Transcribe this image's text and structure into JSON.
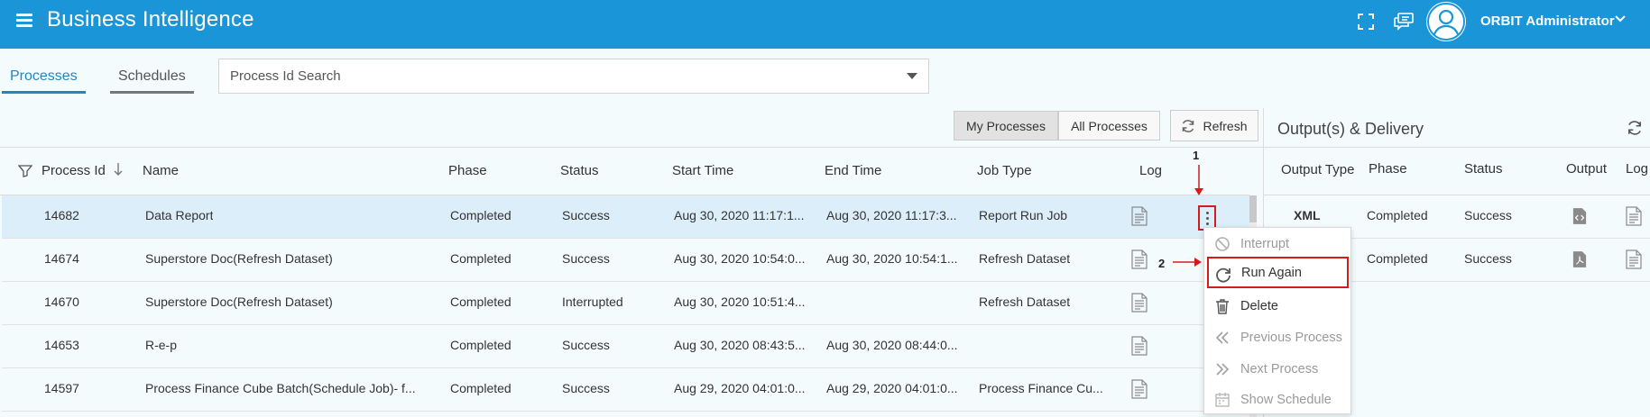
{
  "header": {
    "app_title": "Business Intelligence",
    "user_name": "ORBIT Administrator",
    "icons": [
      "menu-icon",
      "fullscreen-icon",
      "chat-icon",
      "avatar-icon",
      "chevron-down-icon"
    ]
  },
  "tabs": [
    {
      "label": "Processes",
      "active": true
    },
    {
      "label": "Schedules",
      "active": false
    }
  ],
  "search": {
    "placeholder": "Process Id Search",
    "value": ""
  },
  "toolbar": {
    "my_processes": "My Processes",
    "all_processes": "All Processes",
    "refresh": "Refresh",
    "selected_filter": "My Processes"
  },
  "table": {
    "columns": [
      "Process Id",
      "Name",
      "Phase",
      "Status",
      "Start Time",
      "End Time",
      "Job Type",
      "Log"
    ],
    "sort_column": "Process Id",
    "rows": [
      {
        "id": "14682",
        "name": "Data Report",
        "phase": "Completed",
        "status": "Success",
        "start": "Aug 30, 2020 11:17:1...",
        "end": "Aug 30, 2020 11:17:3...",
        "job": "Report Run Job",
        "selected": true
      },
      {
        "id": "14674",
        "name": "Superstore Doc(Refresh Dataset)",
        "phase": "Completed",
        "status": "Success",
        "start": "Aug 30, 2020 10:54:0...",
        "end": "Aug 30, 2020 10:54:1...",
        "job": "Refresh Dataset",
        "selected": false
      },
      {
        "id": "14670",
        "name": "Superstore Doc(Refresh Dataset)",
        "phase": "Completed",
        "status": "Interrupted",
        "start": "Aug 30, 2020 10:51:4...",
        "end": "",
        "job": "Refresh Dataset",
        "selected": false
      },
      {
        "id": "14653",
        "name": "R-e-p",
        "phase": "Completed",
        "status": "Success",
        "start": "Aug 30, 2020 08:43:5...",
        "end": "Aug 30, 2020 08:44:0...",
        "job": "",
        "selected": false
      },
      {
        "id": "14597",
        "name": "Process Finance Cube Batch(Schedule Job)- f...",
        "phase": "Completed",
        "status": "Success",
        "start": "Aug 29, 2020 04:01:0...",
        "end": "Aug 29, 2020 04:01:0...",
        "job": "Process Finance Cu...",
        "selected": false
      }
    ]
  },
  "output_panel": {
    "title": "Output(s) & Delivery",
    "columns": [
      "Output Type",
      "Phase",
      "Status",
      "Output",
      "Log"
    ],
    "rows": [
      {
        "type": "XML",
        "phase": "Completed",
        "status": "Success"
      },
      {
        "type": "",
        "phase": "Completed",
        "status": "Success"
      }
    ]
  },
  "context_menu": {
    "items": [
      {
        "label": "Interrupt",
        "enabled": false,
        "icon": "ban-icon"
      },
      {
        "label": "Run Again",
        "enabled": true,
        "icon": "rerun-icon",
        "highlighted": true
      },
      {
        "label": "Delete",
        "enabled": true,
        "icon": "trash-icon"
      },
      {
        "label": "Previous Process",
        "enabled": false,
        "icon": "chevrons-left-icon"
      },
      {
        "label": "Next Process",
        "enabled": false,
        "icon": "chevrons-right-icon"
      },
      {
        "label": "Show Schedule",
        "enabled": false,
        "icon": "calendar-icon"
      }
    ]
  },
  "annotations": {
    "step1": "1",
    "step2": "2"
  },
  "colors": {
    "topbar": "#1a96d8",
    "accent": "#1a88c8",
    "highlight": "#d31d1d",
    "selected_row": "#dbeef9"
  }
}
